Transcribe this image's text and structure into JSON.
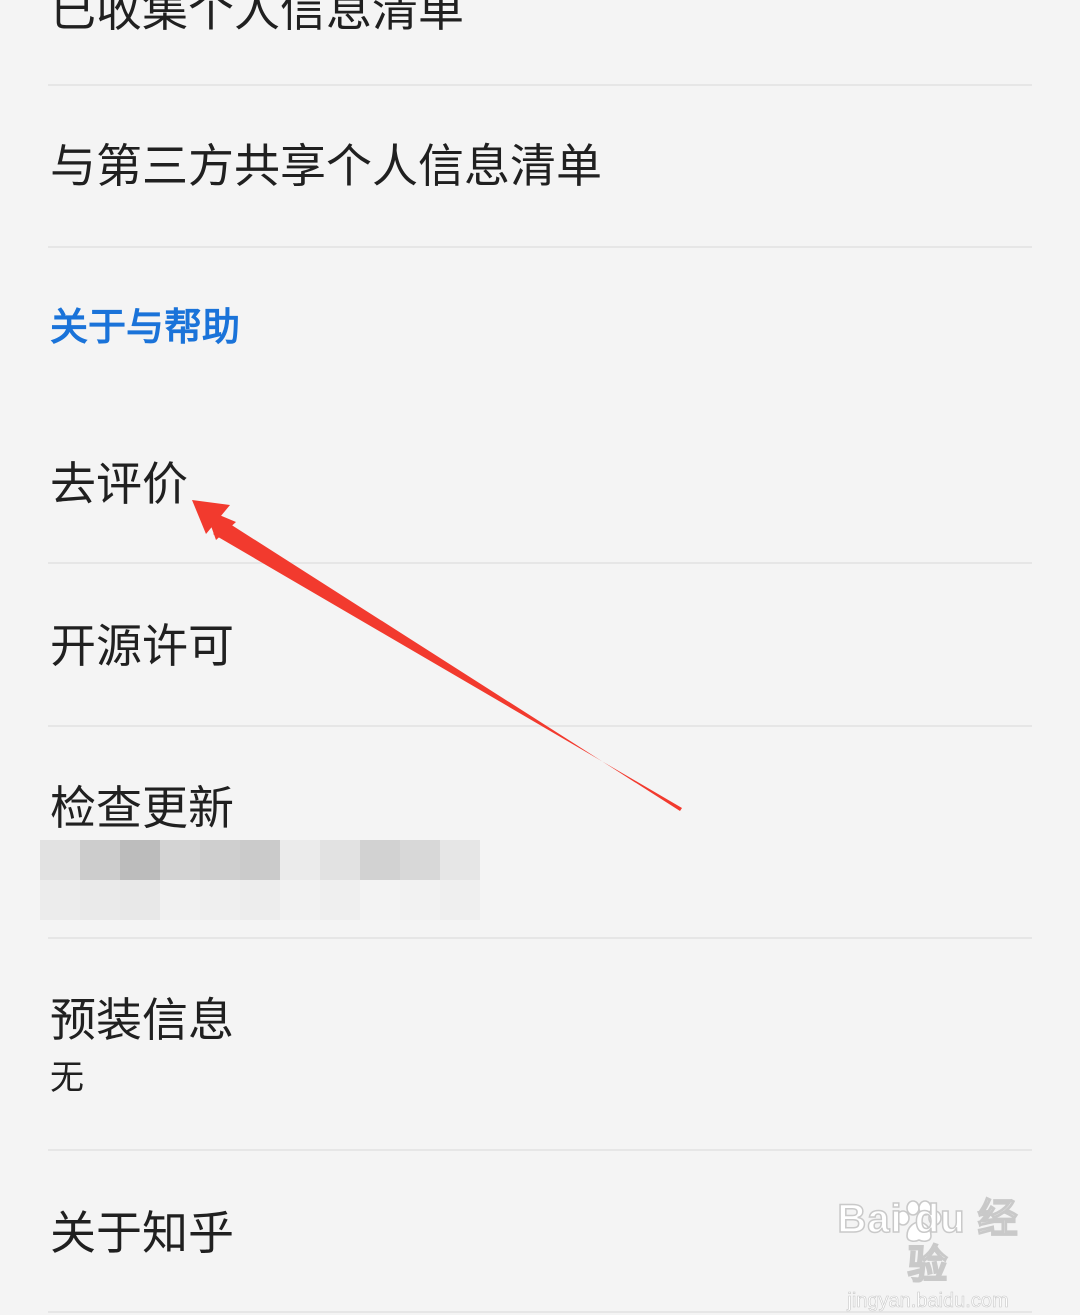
{
  "settings": {
    "items": [
      {
        "label": "已收集个人信息清单"
      },
      {
        "label": "与第三方共享个人信息清单"
      }
    ],
    "section_about": {
      "header": "关于与帮助",
      "items": [
        {
          "label": "去评价"
        },
        {
          "label": "开源许可"
        },
        {
          "label": "检查更新"
        },
        {
          "label": "预装信息",
          "sub": "无"
        },
        {
          "label": "关于知乎"
        }
      ]
    }
  },
  "colors": {
    "background": "#f4f4f4",
    "section_header": "#1a73d9",
    "divider": "#e6e6e6",
    "arrow": "#f23a2e"
  },
  "watermark": {
    "brand": "Bai du 经验",
    "url": "jingyan.baidu.com"
  }
}
